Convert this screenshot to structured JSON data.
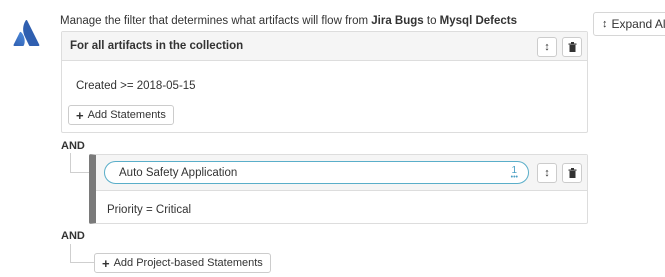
{
  "description": {
    "prefix": "Manage the filter that determines what artifacts will flow from ",
    "source": "Jira Bugs",
    "middle": " to ",
    "target": "Mysql Defects"
  },
  "expand_all": {
    "label": "Expand All",
    "icon": "up-down-arrow-icon"
  },
  "collection_block": {
    "title": "For all artifacts in the collection",
    "statement": "Created >= 2018-05-15",
    "add_statements_label": "Add Statements"
  },
  "and_label_1": "AND",
  "project_block": {
    "project_name": "Auto Safety Application",
    "count": "1",
    "statement": "Priority = Critical"
  },
  "and_label_2": "AND",
  "add_project_statements_label": "Add Project-based Statements",
  "colors": {
    "logo_blue": "#2f5fb0",
    "pill_border": "#5aaec9",
    "project_bar": "#7a7a7a"
  }
}
